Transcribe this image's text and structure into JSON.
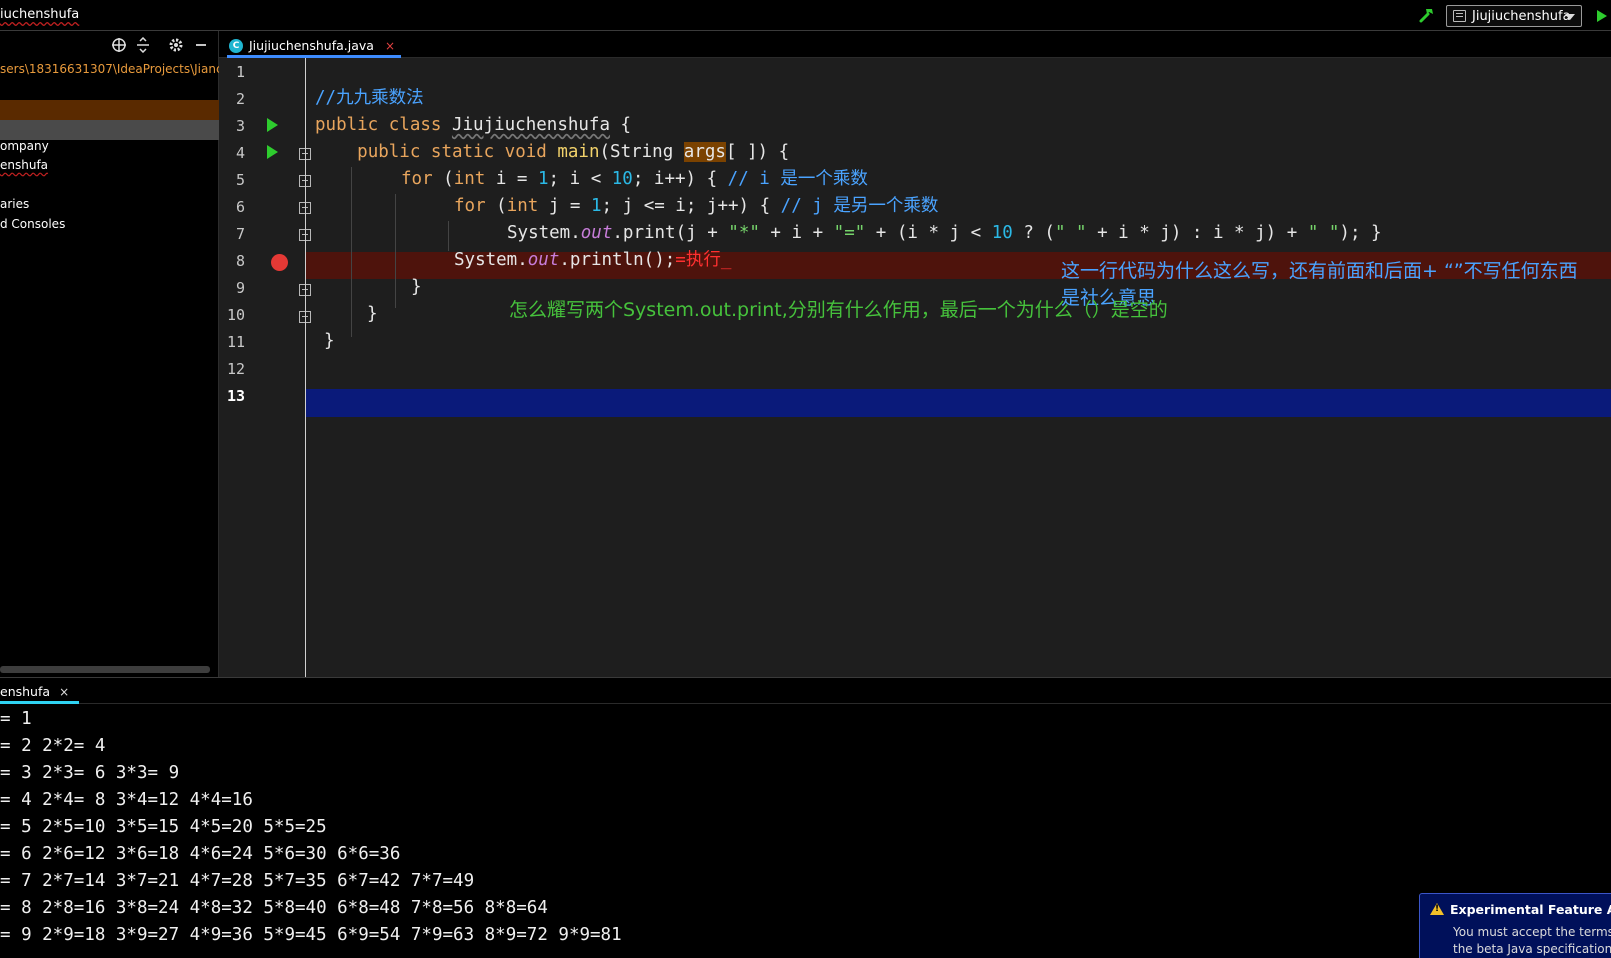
{
  "titlebar": {
    "project_name": "iuchenshufa",
    "run_config": "Jiujiuchenshufa"
  },
  "project_panel": {
    "path": "sers\\18316631307\\IdeaProjects\\Jianch",
    "items": [
      "ompany",
      "enshufa",
      "aries",
      "d Consoles"
    ]
  },
  "editor": {
    "tab_label": "Jiujiuchenshufa.java",
    "tab_close": "×",
    "line_numbers": [
      "1",
      "2",
      "3",
      "4",
      "5",
      "6",
      "7",
      "8",
      "9",
      "10",
      "11",
      "12",
      "13"
    ],
    "lines": {
      "l2_comment": "//九九乘数法",
      "l3_public": "public class ",
      "l3_class": "Jiujiuchenshufa",
      "l3_brace": " {",
      "l4_indent": "    ",
      "l4_kw": "public static void ",
      "l4_main": "main",
      "l4_sig": "(String ",
      "l4_args": "args",
      "l4_rest": "[ ]) {",
      "l5_for": "for ",
      "l5_a": "(",
      "l5_int": "int",
      "l5_b": " i = ",
      "l5_n1": "1",
      "l5_c": "; i < ",
      "l5_n2": "10",
      "l5_d": "; i++) { ",
      "l5_cmt": "// i 是一个乘数",
      "l6_for": "for ",
      "l6_a": "(",
      "l6_int": "int",
      "l6_b": " j = ",
      "l6_n1": "1",
      "l6_c": "; j <= i; j++) { ",
      "l6_cmt": "// j 是另一个乘数",
      "l7_a": "System.",
      "l7_out": "out",
      "l7_b": ".print(j + ",
      "l7_s1": "\"*\"",
      "l7_c": " + i + ",
      "l7_s2": "\"=\"",
      "l7_d": " + (i * j < ",
      "l7_n": "10",
      "l7_e": " ? (",
      "l7_s3": "\" \"",
      "l7_f": " + i * j) : i * j) + ",
      "l7_s4": "\" \"",
      "l7_g": "); }",
      "l8_a": "System.",
      "l8_out": "out",
      "l8_b": ".println();",
      "l8_red": "=执行_",
      "l9": "}",
      "l10": "}",
      "l11": "}"
    },
    "annotation_blue": "这一行代码为什么这么写，还有前面和后面+ “”不写任何东西是社么意思",
    "annotation_green": "怎么耀写两个System.out.print,分别有什么作用，最后一个为什么（）是空的"
  },
  "run_panel": {
    "tab_label": "enshufa",
    "tab_close": "×",
    "output": [
      "= 1",
      "= 2 2*2= 4",
      "= 3 2*3= 6 3*3= 9",
      "= 4 2*4= 8 3*4=12 4*4=16",
      "= 5 2*5=10 3*5=15 4*5=20 5*5=25",
      "= 6 2*6=12 3*6=18 4*6=24 5*6=30 6*6=36",
      "= 7 2*7=14 3*7=21 4*7=28 5*7=35 6*7=42 7*7=49",
      "= 8 2*8=16 3*8=24 4*8=32 5*8=40 6*8=48 7*8=56 8*8=64",
      "= 9 2*9=18 3*9=27 4*9=36 5*9=45 6*9=54 7*9=63 8*9=72 9*9=81"
    ]
  },
  "notification": {
    "title": "Experimental Feature Aler",
    "body_line1": "You must accept the terms",
    "body_line2": "the beta Java specification"
  },
  "colors": {
    "keyword": "#e8a55d",
    "comment": "#4aa3ff",
    "number": "#2bb9e6",
    "string": "#76d46b",
    "breakpoint_line": "#4e130c",
    "caret_line": "#0a1a7a",
    "run_green": "#2ecc2e"
  }
}
